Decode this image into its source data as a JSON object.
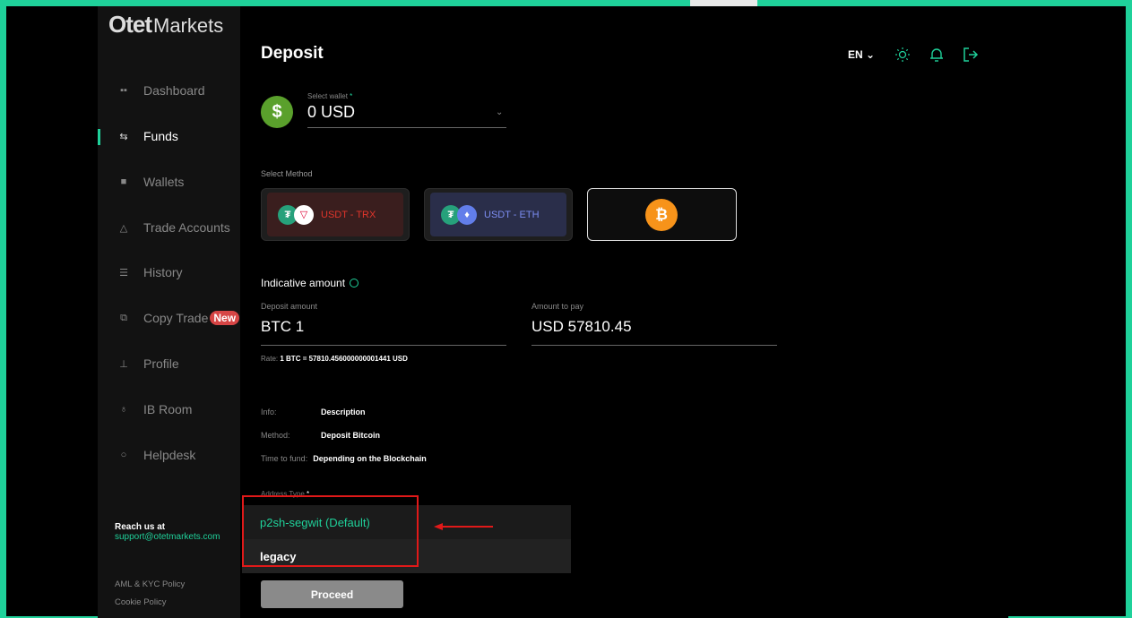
{
  "app": {
    "brand_logo": "Otet",
    "brand_suffix": "Markets"
  },
  "sidebar": {
    "items": [
      {
        "label": "Dashboard",
        "icon": "dashboard-icon"
      },
      {
        "label": "Funds",
        "icon": "transfer-icon",
        "active": true
      },
      {
        "label": "Wallets",
        "icon": "wallet-icon"
      },
      {
        "label": "Trade Accounts",
        "icon": "trade-icon"
      },
      {
        "label": "History",
        "icon": "history-icon"
      },
      {
        "label": "Copy Trade",
        "icon": "copy-icon",
        "badge": "New"
      },
      {
        "label": "Profile",
        "icon": "profile-icon"
      },
      {
        "label": "IB Room",
        "icon": "ib-icon"
      },
      {
        "label": "Helpdesk",
        "icon": "chat-icon"
      }
    ],
    "reach_title": "Reach us at",
    "reach_email": "support@otetmarkets.com",
    "policies": [
      "AML & KYC Policy",
      "Cookie Policy"
    ]
  },
  "header": {
    "title": "Deposit",
    "language": "EN"
  },
  "wallet": {
    "label": "Select wallet",
    "required_mark": "*",
    "value": "0 USD",
    "coin_symbol": "$"
  },
  "methods": {
    "label": "Select Method",
    "options": [
      {
        "label": "USDT - TRX",
        "color": "#e0352b"
      },
      {
        "label": "USDT - ETH",
        "color": "#7b8cf0"
      },
      {
        "label": "",
        "coin": "bitcoin-icon"
      }
    ]
  },
  "amount": {
    "indicative_label": "Indicative amount",
    "deposit_label": "Deposit amount",
    "deposit_value": "BTC 1",
    "pay_label": "Amount to pay",
    "pay_value": "USD 57810.45",
    "rate_label": "Rate:",
    "rate_value": "1 BTC = 57810.456000000001441 USD"
  },
  "info": {
    "info_key": "Info:",
    "info_value": "Description",
    "method_key": "Method:",
    "method_value": "Deposit Bitcoin",
    "time_key": "Time to fund:",
    "time_value": "Depending on the Blockchain"
  },
  "address": {
    "label": "Address Type",
    "required_mark": "*",
    "options": [
      "p2sh-segwit (Default)",
      "legacy"
    ]
  },
  "actions": {
    "proceed": "Proceed"
  },
  "colors": {
    "accent": "#1fd19a",
    "highlight": "#e01919",
    "btc": "#f7931a"
  }
}
